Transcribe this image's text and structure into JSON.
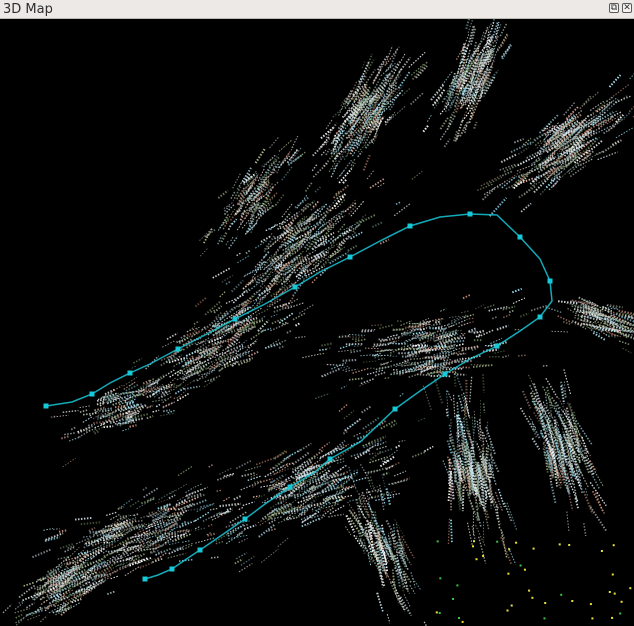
{
  "window": {
    "title": "3D Map",
    "float_symbol": "⧉",
    "close_symbol": "✕"
  },
  "colors": {
    "background": "#000000",
    "trajectory": "#16c8d8",
    "titlebar": "#ece9e6"
  },
  "icons": [
    "float-icon",
    "close-icon"
  ]
}
